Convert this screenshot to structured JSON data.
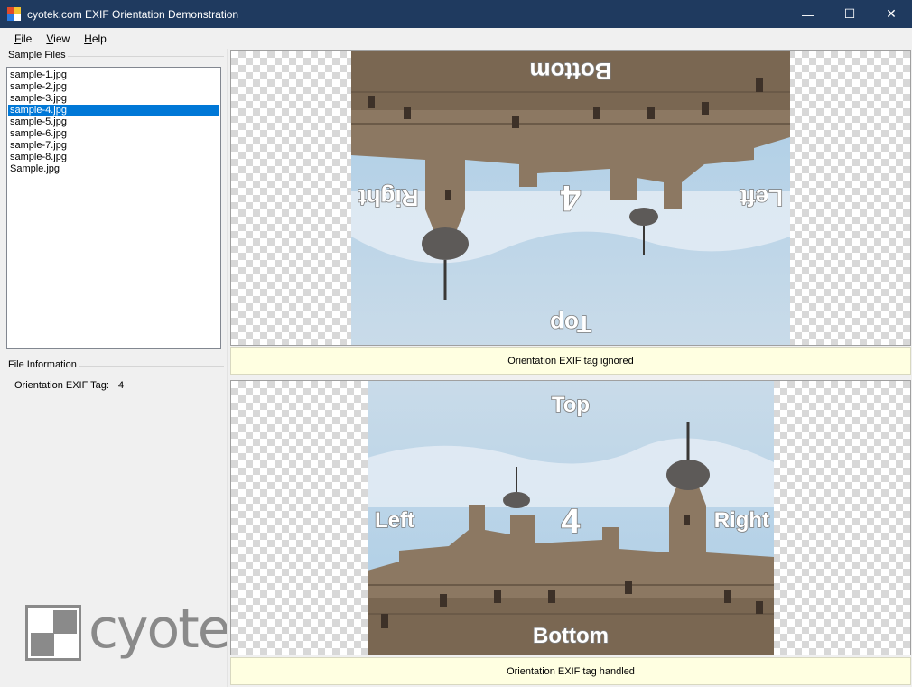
{
  "window": {
    "title": "cyotek.com EXIF Orientation Demonstration",
    "minimize_glyph": "—",
    "maximize_glyph": "☐",
    "close_glyph": "✕"
  },
  "menu": [
    {
      "accel": "F",
      "rest": "ile"
    },
    {
      "accel": "V",
      "rest": "iew"
    },
    {
      "accel": "H",
      "rest": "elp"
    }
  ],
  "sample_files": {
    "title": "Sample Files",
    "items": [
      "sample-1.jpg",
      "sample-2.jpg",
      "sample-3.jpg",
      "sample-4.jpg",
      "sample-5.jpg",
      "sample-6.jpg",
      "sample-7.jpg",
      "sample-8.jpg",
      "Sample.jpg"
    ],
    "selected_index": 3
  },
  "file_info": {
    "title": "File Information",
    "orientation_label": "Orientation EXIF Tag:",
    "orientation_value": "4"
  },
  "logo": {
    "text": "cyotek"
  },
  "image_labels": {
    "top": "Top",
    "bottom": "Bottom",
    "left": "Left",
    "right": "Right",
    "center": "4"
  },
  "panes": {
    "top_caption": "Orientation EXIF tag ignored",
    "bottom_caption": "Orientation EXIF tag handled"
  },
  "colors": {
    "titlebar": "#1f3a5f",
    "selection": "#0078d7",
    "caption_bg": "#ffffe1"
  }
}
